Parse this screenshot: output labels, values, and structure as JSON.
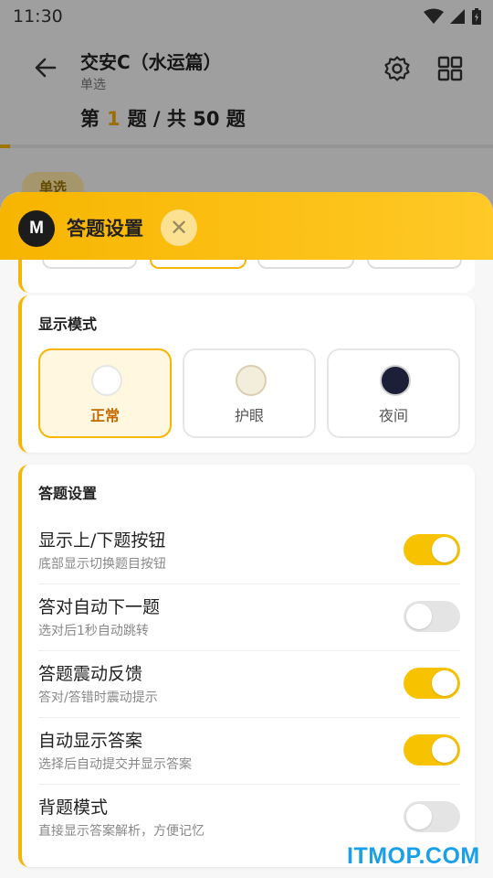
{
  "statusbar": {
    "time": "11:30"
  },
  "header": {
    "title": "交安C（水运篇）",
    "subtitle": "单选",
    "progress_prefix": "第",
    "current": "1",
    "progress_suffix": "题 / 共 50 题",
    "progress_fraction": 0.02
  },
  "question_type_pill": "单选",
  "sheet": {
    "avatar_letter": "M",
    "title": "答题设置",
    "close_glyph": "✕"
  },
  "display_mode": {
    "section_title": "显示模式",
    "options": [
      {
        "label": "正常",
        "color": "#ffffff",
        "selected": true
      },
      {
        "label": "护眼",
        "color": "#f3eddc",
        "selected": false
      },
      {
        "label": "夜间",
        "color": "#1c1f38",
        "selected": false
      }
    ]
  },
  "answer_settings": {
    "section_title": "答题设置",
    "items": [
      {
        "title": "显示上/下题按钮",
        "desc": "底部显示切换题目按钮",
        "on": true
      },
      {
        "title": "答对自动下一题",
        "desc": "选对后1秒自动跳转",
        "on": false
      },
      {
        "title": "答题震动反馈",
        "desc": "答对/答错时震动提示",
        "on": true
      },
      {
        "title": "自动显示答案",
        "desc": "选择后自动提交并显示答案",
        "on": true
      },
      {
        "title": "背题模式",
        "desc": "直接显示答案解析，方便记忆",
        "on": false
      }
    ]
  },
  "watermark": "ITMOP.COM",
  "colors": {
    "accent": "#f7b500",
    "toggle_on": "#f7c300",
    "watermark": "#1aa0e8"
  },
  "icons": [
    "back-arrow-icon",
    "settings-gear-icon",
    "grid-icon",
    "wifi-icon",
    "signal-icon",
    "battery-icon",
    "close-icon"
  ]
}
